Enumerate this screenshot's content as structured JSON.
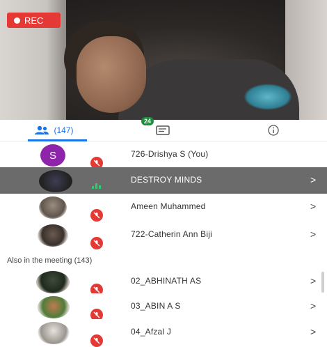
{
  "video": {
    "rec_label": "REC"
  },
  "tabs": {
    "people_count": "(147)",
    "chat_badge": "24"
  },
  "participants": [
    {
      "name": "726-Drishya S (You)",
      "avatar_letter": "S",
      "muted": true,
      "has_chevron": false
    },
    {
      "name": "DESTROY MINDS",
      "muted": false,
      "speaking": true,
      "has_chevron": true,
      "highlighted": true
    },
    {
      "name": "Ameen Muhammed",
      "muted": true,
      "has_chevron": true
    },
    {
      "name": "722-Catherin Ann Biji",
      "muted": true,
      "has_chevron": true
    }
  ],
  "also_in_meeting": {
    "label": "Also in the meeting (143)",
    "items": [
      {
        "name": "02_ABHINATH AS",
        "muted": true,
        "has_chevron": true
      },
      {
        "name": "03_ABIN A S",
        "muted": true,
        "has_chevron": true
      },
      {
        "name": "04_Afzal J",
        "muted": true,
        "has_chevron": true
      }
    ]
  },
  "chevron": ">",
  "colors": {
    "accent": "#1a73e8",
    "rec": "#e53935",
    "mute": "#e53935",
    "badge": "#1e8e3e",
    "avatar_s": "#8e24aa"
  }
}
